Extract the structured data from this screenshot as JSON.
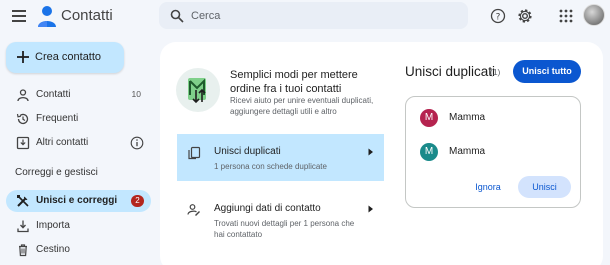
{
  "header": {
    "app_title": "Contatti",
    "search_placeholder": "Cerca",
    "icons": [
      "menu-icon",
      "contacts-logo-icon",
      "search-icon",
      "help-icon",
      "settings-icon",
      "apps-grid-icon",
      "avatar"
    ]
  },
  "sidebar": {
    "create_label": "Crea contatto",
    "items": [
      {
        "label": "Contatti",
        "count": "10",
        "icon": "person-icon"
      },
      {
        "label": "Frequenti",
        "icon": "history-icon"
      },
      {
        "label": "Altri contatti",
        "icon": "download-box-icon"
      }
    ],
    "section_title": "Correggi e gestisci",
    "manage_items": [
      {
        "label": "Unisci e correggi",
        "badge": "2",
        "icon": "tools-icon"
      },
      {
        "label": "Importa",
        "icon": "import-icon"
      },
      {
        "label": "Cestino",
        "icon": "trash-icon"
      }
    ]
  },
  "main": {
    "intro_title": "Semplici modi per mettere ordine fra i tuoi contatti",
    "intro_subtitle": "Ricevi aiuto per unire eventuali duplicati, aggiungere dettagli utili e altro",
    "options": [
      {
        "title": "Unisci duplicati",
        "subtitle": "1 persona con schede duplicate"
      },
      {
        "title": "Aggiungi dati di contatto",
        "subtitle": "Trovati nuovi dettagli per 1 persona che hai contattato"
      }
    ],
    "duplicates": {
      "title": "Unisci duplicati",
      "count": "(1)",
      "merge_all_label": "Unisci tutto",
      "contacts": [
        {
          "initial": "M",
          "name": "Mamma",
          "color": "#b5234f"
        },
        {
          "initial": "M",
          "name": "Mamma",
          "color": "#1a8a8a"
        }
      ],
      "ignore_label": "Ignora",
      "merge_label": "Unisci"
    }
  },
  "colors": {
    "accent": "#0b57d0",
    "selected_bg": "#c2e7ff",
    "badge": "#b3261e"
  }
}
